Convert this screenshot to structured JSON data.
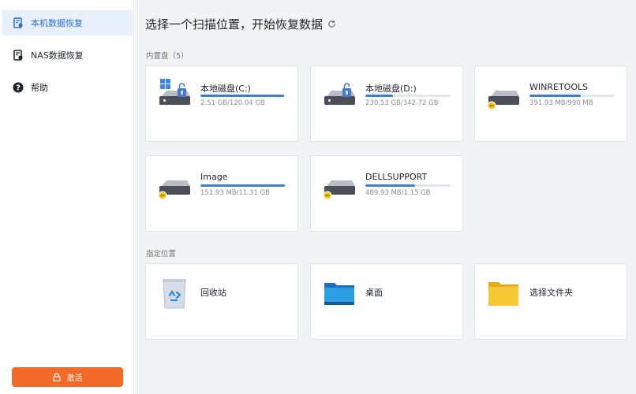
{
  "sidebar": {
    "items": [
      {
        "label": "本机数据恢复",
        "icon": "local-recovery-icon",
        "active": true
      },
      {
        "label": "NAS数据恢复",
        "icon": "nas-icon",
        "active": false
      },
      {
        "label": "帮助",
        "icon": "help-icon",
        "active": false
      }
    ],
    "activate_label": "激活"
  },
  "main": {
    "title": "选择一个扫描位置，开始恢复数据",
    "builtin_section": "内置盘（5）",
    "custom_section": "指定位置",
    "drives": [
      {
        "name": "本地磁盘(C:)",
        "size": "2.51 GB/120.04 GB",
        "fill": 0.98,
        "icon": "windows-system-drive-icon"
      },
      {
        "name": "本地磁盘(D:)",
        "size": "230.53 GB/342.72 GB",
        "fill": 0.32,
        "icon": "locked-drive-icon"
      },
      {
        "name": "WINRETOOLS",
        "size": "391.93 MB/990 MB",
        "fill": 0.6,
        "icon": "drive-icon"
      },
      {
        "name": "Image",
        "size": "151.93 MB/11.31 GB",
        "fill": 0.99,
        "icon": "drive-icon"
      },
      {
        "name": "DELLSUPPORT",
        "size": "489.93 MB/1.15 GB",
        "fill": 0.58,
        "icon": "drive-icon"
      }
    ],
    "locations": [
      {
        "name": "回收站",
        "icon": "recycle-bin-icon"
      },
      {
        "name": "桌面",
        "icon": "desktop-folder-icon"
      },
      {
        "name": "选择文件夹",
        "icon": "folder-icon"
      }
    ]
  },
  "colors": {
    "accent": "#3a7de0",
    "activate": "#f26a27",
    "active_bg": "#e8f0fb"
  }
}
